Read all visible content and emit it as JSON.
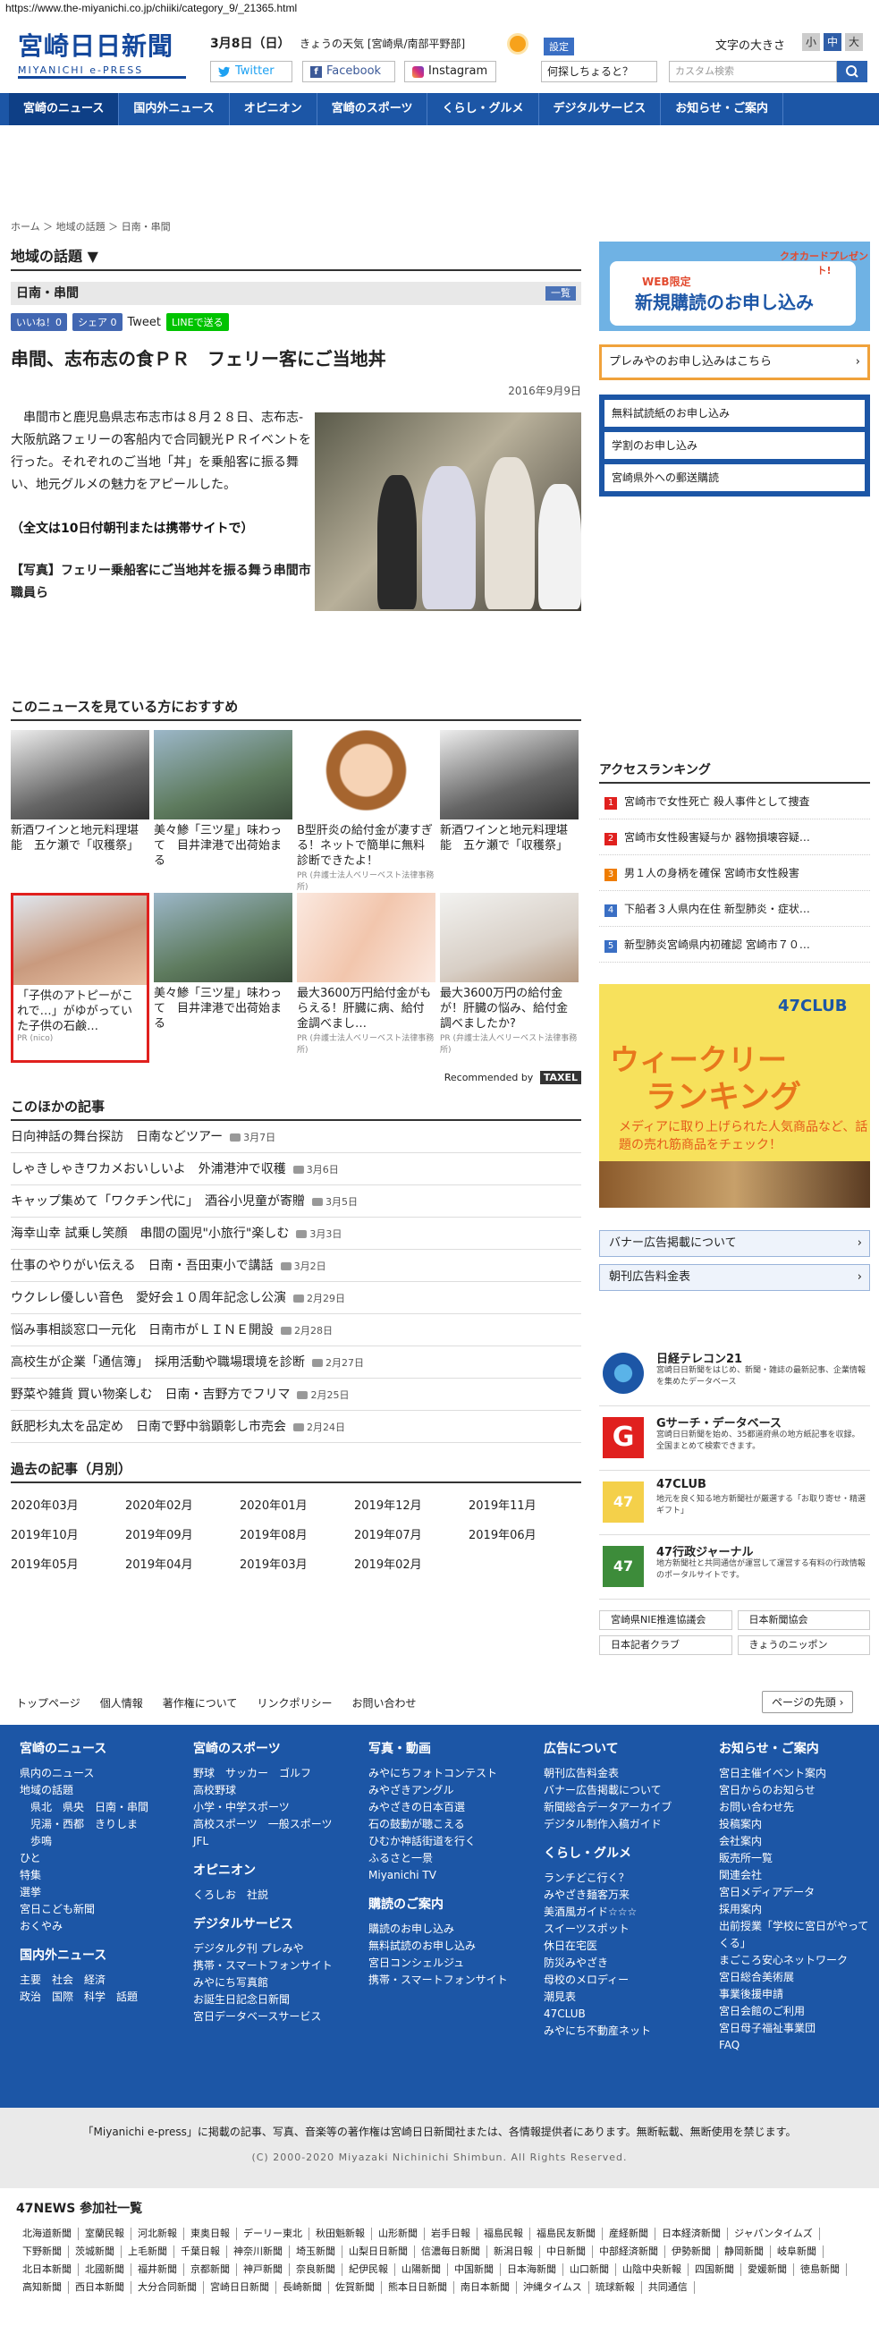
{
  "url": "https://www.the-miyanichi.co.jp/chiiki/category_9/_21365.html",
  "header": {
    "logo_jp": "宮崎日日新聞",
    "logo_en": "MIYANICHI e-PRESS",
    "date": "3月8日（日）",
    "weather": "きょうの天気 [宮崎県/南部平野部]",
    "settings": "設定",
    "font_size_label": "文字の大きさ",
    "font_small": "小",
    "font_medium": "中",
    "font_large": "大",
    "twitter": "Twitter",
    "facebook": "Facebook",
    "instagram": "Instagram",
    "question": "何探しちょると？",
    "search_placeholder": "カスタム検索"
  },
  "nav": [
    "宮崎のニュース",
    "国内外ニュース",
    "オピニオン",
    "宮崎のスポーツ",
    "くらし・グルメ",
    "デジタルサービス",
    "お知らせ・ご案内"
  ],
  "breadcrumb": "ホーム ＞ 地域の話題 ＞ 日南・串間",
  "section_title": "地域の話題 ▼",
  "subsection": "日南・串間",
  "list_button": "一覧",
  "share": {
    "like": "いいね！0",
    "fb_share": "シェア 0",
    "tweet": "Tweet",
    "line": "LINEで送る"
  },
  "article": {
    "title": "串間、志布志の食ＰＲ　フェリー客にご当地丼",
    "date": "2016年9月9日",
    "body": "串間市と鹿児島県志布志市は８月２８日、志布志‐大阪航路フェリーの客船内で合同観光ＰＲイベントを行った。それぞれのご当地「丼」を乗船客に振る舞い、地元グルメの魅力をアピールした。",
    "fulltext": "（全文は10日付朝刊または携帯サイトで）",
    "caption": "【写真】フェリー乗船客にご当地丼を振る舞う串間市職員ら"
  },
  "recommend": {
    "heading": "このニュースを見ている方におすすめ",
    "items": [
      {
        "title": "新酒ワインと地元料理堪能　五ケ瀬で「収穫祭」",
        "pr": ""
      },
      {
        "title": "美々鯵「三ツ星」味わって　目井津港で出荷始まる",
        "pr": ""
      },
      {
        "title": "B型肝炎の給付金が凄すぎる！ネットで簡単に無料診断できたよ！",
        "pr": "PR (弁護士法人ベリーベスト法律事務所)"
      },
      {
        "title": "新酒ワインと地元料理堪能　五ケ瀬で「収穫祭」",
        "pr": ""
      },
      {
        "title": "「子供のアトピーがこれで…」がゆがっていた子供の石鹸…",
        "pr": "PR (nico)"
      },
      {
        "title": "美々鯵「三ツ星」味わって　目井津港で出荷始まる",
        "pr": ""
      },
      {
        "title": "最大3600万円給付金がもらえる！肝臓に病、給付金調べまし…",
        "pr": "PR (弁護士法人ベリーベスト法律事務所)"
      },
      {
        "title": "最大3600万円の給付金が！肝臓の悩み、給付金調べましたか?",
        "pr": "PR (弁護士法人ベリーベスト法律事務所)"
      }
    ],
    "footer": "Recommended by",
    "brand": "TAXEL"
  },
  "others": {
    "heading": "このほかの記事",
    "items": [
      {
        "t": "日向神話の舞台探訪　日南などツアー",
        "d": "3月7日"
      },
      {
        "t": "しゃきしゃきワカメおいしいよ　外浦港沖で収穫",
        "d": "3月6日"
      },
      {
        "t": "キャップ集めて「ワクチン代に」　酒谷小児童が寄贈",
        "d": "3月5日"
      },
      {
        "t": "海幸山幸 試乗し笑顔　串間の園児\"小旅行\"楽しむ",
        "d": "3月3日"
      },
      {
        "t": "仕事のやりがい伝える　日南・吾田東小で講話",
        "d": "3月2日"
      },
      {
        "t": "ウクレレ優しい音色　愛好会１０周年記念し公演",
        "d": "2月29日"
      },
      {
        "t": "悩み事相談窓口一元化　日南市がＬＩＮＥ開設",
        "d": "2月28日"
      },
      {
        "t": "高校生が企業「通信簿」　採用活動や職場環境を診断",
        "d": "2月27日"
      },
      {
        "t": "野菜や雑貨 買い物楽しむ　日南・吉野方でフリマ",
        "d": "2月25日"
      },
      {
        "t": "飫肥杉丸太を品定め　日南で野中翁顕彰し市売会",
        "d": "2月24日"
      }
    ]
  },
  "archive": {
    "heading": "過去の記事（月別）",
    "months": [
      "2020年03月",
      "2020年02月",
      "2020年01月",
      "2019年12月",
      "2019年11月",
      "2019年10月",
      "2019年09月",
      "2019年08月",
      "2019年07月",
      "2019年06月",
      "2019年05月",
      "2019年04月",
      "2019年03月",
      "2019年02月"
    ]
  },
  "sidebar": {
    "banner1_a": "WEB限定",
    "banner1_b": "新規購読のお申し込み",
    "banner1_c": "クオカードプレゼント!",
    "banner2": "プレみやのお申し込みはこちら",
    "blue_links": [
      "無料試読紙のお申し込み",
      "学割のお申し込み",
      "宮崎県外への郵送購読"
    ],
    "ranking_heading": "アクセスランキング",
    "ranking": [
      {
        "n": "1",
        "t": "宮崎市で女性死亡 殺人事件として捜査"
      },
      {
        "t": "宮崎市女性殺害疑与か 器物損壊容疑…",
        "n": "2"
      },
      {
        "n": "3",
        "t": "男１人の身柄を確保 宮崎市女性殺害"
      },
      {
        "n": "4",
        "t": "下船者３人県内在住 新型肺炎・症状…"
      },
      {
        "n": "5",
        "t": "新型肺炎宮崎県内初確認 宮崎市７０…"
      }
    ],
    "club_logo": "47CLUB",
    "club_t1": "ウィークリー",
    "club_t2": "ランキング",
    "club_t3": "メディアに取り上げられた人気商品など、話題の売れ筋商品をチェック！",
    "links": [
      "バナー広告掲載について",
      "朝刊広告料金表"
    ],
    "services": [
      {
        "t": "日経テレコン21",
        "d": "宮崎日日新聞をはじめ、新聞・雑誌の最新記事、企業情報を集めたデータベース"
      },
      {
        "t": "Gサーチ・データベース",
        "d": "宮崎日日新聞を始め、35都道府県の地方紙記事を収録。全国まとめて検索できます。"
      },
      {
        "t": "47CLUB",
        "d": "地元を良く知る地方新聞社が厳選する「お取り寄せ・精選ギフト」"
      },
      {
        "t": "47行政ジャーナル",
        "d": "地方新聞社と共同通信が運営して運営する有料の行政情報のポータルサイトです。"
      }
    ],
    "tiny": [
      "宮崎県NIE推進協議会",
      "日本新聞協会",
      "日本記者クラブ",
      "きょうのニッポン"
    ]
  },
  "footer": {
    "nav": [
      "トップページ",
      "個人情報",
      "著作権について",
      "リンクポリシー",
      "お問い合わせ"
    ],
    "top": "ページの先頭",
    "col1_h": "宮崎のニュース",
    "col1": [
      "県内のニュース",
      "地域の話題",
      "　県北　県央　日南・串間",
      "　児湯・西都　きりしま",
      "　歩鳴",
      "ひと",
      "特集",
      "選挙",
      "宮日こども新聞",
      "おくやみ"
    ],
    "col1b_h": "国内外ニュース",
    "col1b": [
      "主要　社会　経済",
      "政治　国際　科学　話題"
    ],
    "col2_h": "宮崎のスポーツ",
    "col2": [
      "野球　サッカー　ゴルフ",
      "高校野球",
      "小学・中学スポーツ",
      "高校スポーツ　一般スポーツ",
      "JFL"
    ],
    "col2b_h": "オピニオン",
    "col2b": [
      "くろしお　社説"
    ],
    "col2c_h": "デジタルサービス",
    "col2c": [
      "デジタル夕刊 プレみや",
      "携帯・スマートフォンサイト",
      "みやにち写真館",
      "お誕生日記念日新聞",
      "宮日データベースサービス"
    ],
    "col3_h": "写真・動画",
    "col3": [
      "みやにちフォトコンテスト",
      "みやざきアングル",
      "みやざきの日本百選",
      "石の鼓動が聴こえる",
      "ひむか神話街道を行く",
      "ふるさと一景",
      "Miyanichi TV"
    ],
    "col3b_h": "購読のご案内",
    "col3b": [
      "購読のお申し込み",
      "無料試読のお申し込み",
      "宮日コンシェルジュ",
      "携帯・スマートフォンサイト"
    ],
    "col4_h": "広告について",
    "col4": [
      "朝刊広告料金表",
      "バナー広告掲載について",
      "新聞総合データアーカイブ",
      "デジタル制作入稿ガイド"
    ],
    "col4b_h": "くらし・グルメ",
    "col4b": [
      "ランチどこ行く？",
      "みやざき麺客万来",
      "美酒風ガイド☆☆☆",
      "スイーツスポット",
      "休日在宅医",
      "防災みやざき",
      "母校のメロディー",
      "潮見表",
      "47CLUB",
      "みやにち不動産ネット"
    ],
    "col5_h": "お知らせ・ご案内",
    "col5": [
      "宮日主催イベント案内",
      "宮日からのお知らせ",
      "お問い合わせ先",
      "投稿案内",
      "会社案内",
      "販売所一覧",
      "関連会社",
      "宮日メディアデータ",
      "採用案内",
      "出前授業「学校に宮日がやってくる」",
      "まごころ安心ネットワーク",
      "宮日総合美術展",
      "事業後援申請",
      "宮日会館のご利用",
      "宮日母子福祉事業団",
      "FAQ"
    ],
    "copyright_note": "「Miyanichi e-press」に掲載の記事、写真、音楽等の著作権は宮崎日日新聞社または、各情報提供者にあります。無断転載、無断使用を禁じます。",
    "copyright": "(C) 2000-2020 Miyazaki Nichinichi Shimbun. All Rights Reserved.",
    "news47_h": "47NEWS 参加社一覧",
    "news47": [
      "北海道新聞",
      "室蘭民報",
      "河北新報",
      "東奥日報",
      "デーリー東北",
      "秋田魁新報",
      "山形新聞",
      "岩手日報",
      "福島民報",
      "福島民友新聞",
      "産経新聞",
      "日本経済新聞",
      "ジャパンタイムズ",
      "下野新聞",
      "茨城新聞",
      "上毛新聞",
      "千葉日報",
      "神奈川新聞",
      "埼玉新聞",
      "山梨日日新聞",
      "信濃毎日新聞",
      "新潟日報",
      "中日新聞",
      "中部経済新聞",
      "伊勢新聞",
      "静岡新聞",
      "岐阜新聞",
      "北日本新聞",
      "北國新聞",
      "福井新聞",
      "京都新聞",
      "神戸新聞",
      "奈良新聞",
      "紀伊民報",
      "山陽新聞",
      "中国新聞",
      "日本海新聞",
      "山口新聞",
      "山陰中央新報",
      "四国新聞",
      "愛媛新聞",
      "徳島新聞",
      "高知新聞",
      "西日本新聞",
      "大分合同新聞",
      "宮崎日日新聞",
      "長崎新聞",
      "佐賀新聞",
      "熊本日日新聞",
      "南日本新聞",
      "沖縄タイムス",
      "琉球新報",
      "共同通信"
    ]
  }
}
